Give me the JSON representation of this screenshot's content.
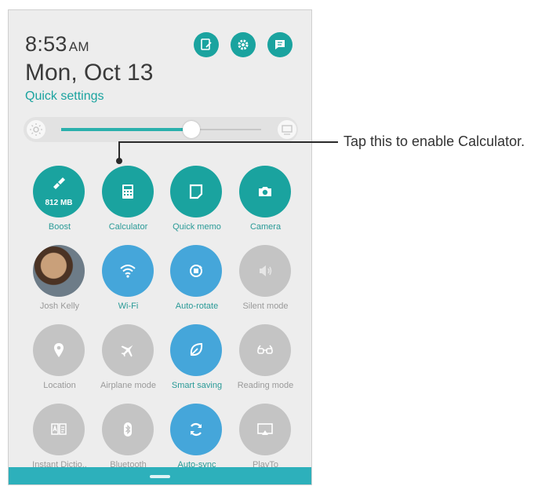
{
  "status": {
    "time": "8:53",
    "ampm": "AM",
    "date": "Mon, Oct 13",
    "quick_settings": "Quick settings"
  },
  "brightness": {
    "level": 0.65,
    "accent": "#2ab0ac"
  },
  "callout": {
    "text": "Tap this to enable Calculator."
  },
  "colors": {
    "teal": "#1aa39f",
    "blue": "#45a6da",
    "gray": "#c4c4c4"
  },
  "tiles": [
    {
      "label": "Boost",
      "icon": "broom-icon",
      "sub": "812 MB",
      "state": "on"
    },
    {
      "label": "Calculator",
      "icon": "calculator-icon",
      "state": "on"
    },
    {
      "label": "Quick memo",
      "icon": "memo-icon",
      "state": "on"
    },
    {
      "label": "Camera",
      "icon": "camera-icon",
      "state": "on"
    },
    {
      "label": "Josh Kelly",
      "icon": "avatar",
      "state": "contact"
    },
    {
      "label": "Wi-Fi",
      "icon": "wifi-icon",
      "state": "blue"
    },
    {
      "label": "Auto-rotate",
      "icon": "rotate-icon",
      "state": "blue"
    },
    {
      "label": "Silent mode",
      "icon": "speaker-icon",
      "state": "off"
    },
    {
      "label": "Location",
      "icon": "location-pin-icon",
      "state": "off"
    },
    {
      "label": "Airplane mode",
      "icon": "airplane-icon",
      "state": "off"
    },
    {
      "label": "Smart saving",
      "icon": "leaf-icon",
      "state": "blue"
    },
    {
      "label": "Reading mode",
      "icon": "glasses-icon",
      "state": "off"
    },
    {
      "label": "Instant Dictio..",
      "icon": "dictionary-icon",
      "state": "off"
    },
    {
      "label": "Bluetooth",
      "icon": "bluetooth-icon",
      "state": "off"
    },
    {
      "label": "Auto-sync",
      "icon": "sync-icon",
      "state": "blue"
    },
    {
      "label": "PlayTo",
      "icon": "cast-icon",
      "state": "off"
    }
  ]
}
